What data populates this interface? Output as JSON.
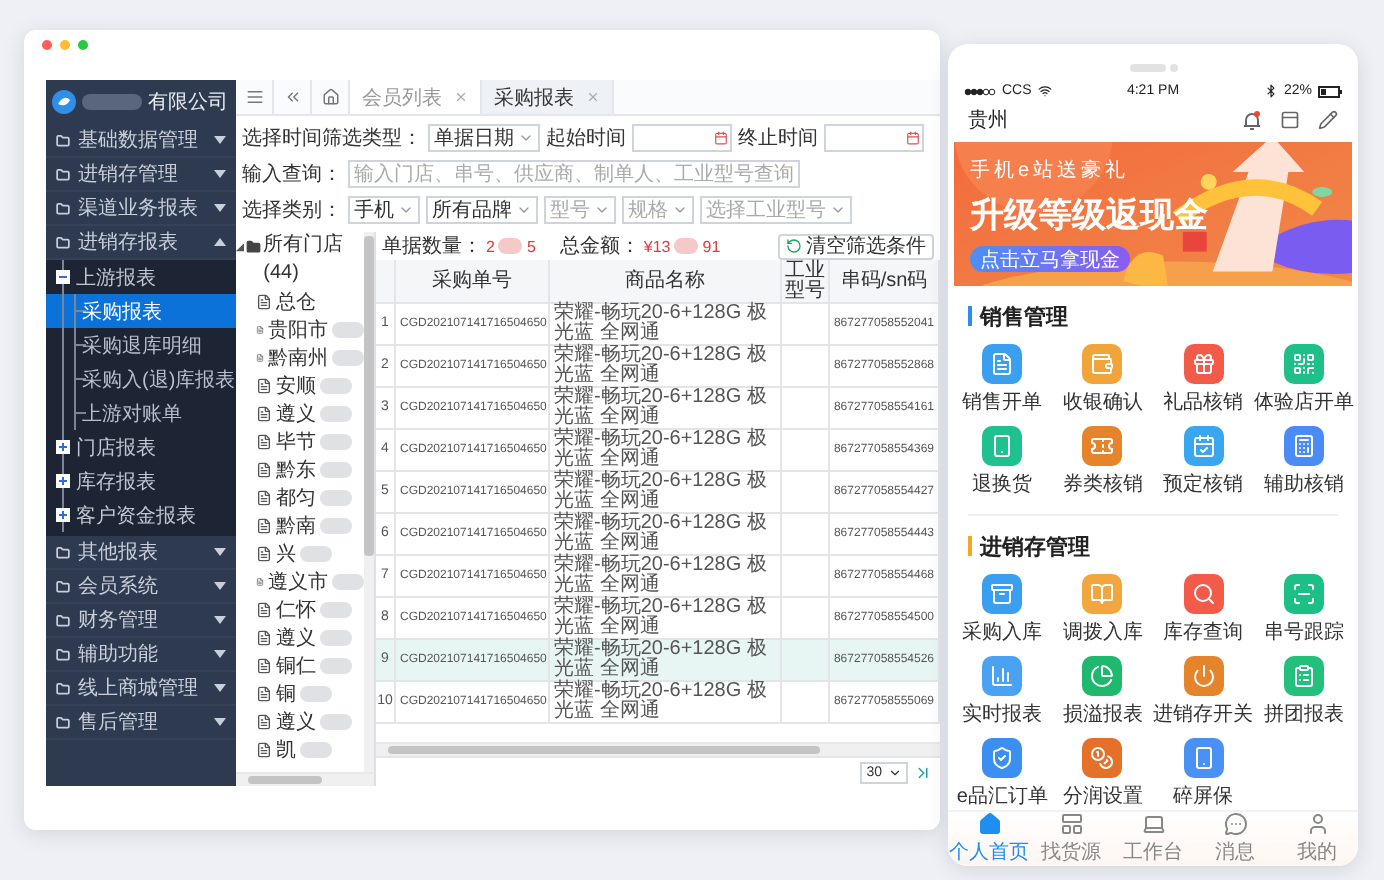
{
  "sidebar": {
    "company": "有限公司",
    "menu": [
      {
        "label": "基础数据管理",
        "expanded": false
      },
      {
        "label": "进销存管理",
        "expanded": false
      },
      {
        "label": "渠道业务报表",
        "expanded": false
      },
      {
        "label": "进销存报表",
        "expanded": true,
        "children": [
          {
            "label": "上游报表",
            "expanded": true,
            "children": [
              {
                "label": "采购报表",
                "selected": true
              },
              {
                "label": "采购退库明细",
                "selected": false
              },
              {
                "label": "采购入(退)库报表",
                "selected": false
              },
              {
                "label": "上游对账单",
                "selected": false
              }
            ]
          },
          {
            "label": "门店报表",
            "expanded": false
          },
          {
            "label": "库存报表",
            "expanded": false
          },
          {
            "label": "客户资金报表",
            "expanded": false
          }
        ]
      },
      {
        "label": "其他报表",
        "expanded": false
      },
      {
        "label": "会员系统",
        "expanded": false
      },
      {
        "label": "财务管理",
        "expanded": false
      },
      {
        "label": "辅助功能",
        "expanded": false
      },
      {
        "label": "线上商城管理",
        "expanded": false
      },
      {
        "label": "售后管理",
        "expanded": false
      }
    ]
  },
  "tabs": [
    {
      "label": "会员列表",
      "selected": false
    },
    {
      "label": "采购报表",
      "selected": true
    }
  ],
  "filters": {
    "time_label": "选择时间筛选类型：",
    "time_type": "单据日期",
    "start_label": "起始时间",
    "end_label": "终止时间",
    "query_label": "输入查询：",
    "query_placeholder": "输入门店、串号、供应商、制单人、工业型号查询",
    "category_label": "选择类别：",
    "dropdowns": [
      {
        "value": "手机"
      },
      {
        "value": "所有品牌"
      },
      {
        "placeholder": "型号"
      },
      {
        "placeholder": "规格"
      },
      {
        "placeholder": "选择工业型号"
      }
    ],
    "clear_button": "清空筛选条件"
  },
  "store_tree": {
    "root": "所有门店 (44)",
    "expanded": true,
    "stores": [
      {
        "name": "总仓",
        "blurred": false
      },
      {
        "name": "贵阳市",
        "blurred": true
      },
      {
        "name": "黔南州",
        "blurred": true
      },
      {
        "name": "安顺",
        "blurred": true
      },
      {
        "name": "遵义",
        "blurred": true
      },
      {
        "name": "毕节",
        "blurred": true
      },
      {
        "name": "黔东",
        "blurred": true
      },
      {
        "name": "都匀",
        "blurred": true
      },
      {
        "name": "黔南",
        "blurred": true
      },
      {
        "name": "兴",
        "blurred": true
      },
      {
        "name": "遵义市",
        "blurred": true
      },
      {
        "name": "仁怀",
        "blurred": true
      },
      {
        "name": "遵义",
        "blurred": true
      },
      {
        "name": "铜仁",
        "blurred": true
      },
      {
        "name": "铜",
        "blurred": true
      },
      {
        "name": "遵义",
        "blurred": true
      },
      {
        "name": "凯",
        "blurred": true
      }
    ]
  },
  "summary": {
    "count_label": "单据数量：",
    "count_parts": [
      "2",
      "5"
    ],
    "amount_label": "总金额：",
    "amount_parts": [
      "¥13",
      "91"
    ]
  },
  "table": {
    "columns": [
      "采购单号",
      "商品名称",
      "工业型号",
      "串码/sn码"
    ],
    "rows": [
      {
        "no": "1",
        "order_no": "CGD202107141716504650",
        "product": "荣耀-畅玩20-6+128G 极光蓝 全网通",
        "imei": "867277058552041",
        "selected": false
      },
      {
        "no": "2",
        "order_no": "CGD202107141716504650",
        "product": "荣耀-畅玩20-6+128G 极光蓝 全网通",
        "imei": "867277058552868",
        "selected": false
      },
      {
        "no": "3",
        "order_no": "CGD202107141716504650",
        "product": "荣耀-畅玩20-6+128G 极光蓝 全网通",
        "imei": "867277058554161",
        "selected": false
      },
      {
        "no": "4",
        "order_no": "CGD202107141716504650",
        "product": "荣耀-畅玩20-6+128G 极光蓝 全网通",
        "imei": "867277058554369",
        "selected": false
      },
      {
        "no": "5",
        "order_no": "CGD202107141716504650",
        "product": "荣耀-畅玩20-6+128G 极光蓝 全网通",
        "imei": "867277058554427",
        "selected": false
      },
      {
        "no": "6",
        "order_no": "CGD202107141716504650",
        "product": "荣耀-畅玩20-6+128G 极光蓝 全网通",
        "imei": "867277058554443",
        "selected": false
      },
      {
        "no": "7",
        "order_no": "CGD202107141716504650",
        "product": "荣耀-畅玩20-6+128G 极光蓝 全网通",
        "imei": "867277058554468",
        "selected": false
      },
      {
        "no": "8",
        "order_no": "CGD202107141716504650",
        "product": "荣耀-畅玩20-6+128G 极光蓝 全网通",
        "imei": "867277058554500",
        "selected": false
      },
      {
        "no": "9",
        "order_no": "CGD202107141716504650",
        "product": "荣耀-畅玩20-6+128G 极光蓝 全网通",
        "imei": "867277058554526",
        "selected": true
      },
      {
        "no": "10",
        "order_no": "CGD202107141716504650",
        "product": "荣耀-畅玩20-6+128G 极光蓝 全网通",
        "imei": "867277058555069",
        "selected": false
      }
    ]
  },
  "pagination": {
    "page_size": "30"
  },
  "phone": {
    "carrier": "CCS",
    "time": "4:21 PM",
    "battery": "22%",
    "city": "贵州",
    "banner": {
      "kicker": "手机e站送豪礼",
      "headline": "升级等级返现金",
      "button": "点击立马拿现金"
    },
    "sections": [
      {
        "title": "销售管理",
        "color": "#2d8cf0",
        "items": [
          {
            "label": "销售开单",
            "color": "#3a9ff0"
          },
          {
            "label": "收银确认",
            "color": "#f0a43a"
          },
          {
            "label": "礼品核销",
            "color": "#f25b4a"
          },
          {
            "label": "体验店开单",
            "color": "#1fbf8a"
          },
          {
            "label": "退换货",
            "color": "#1fc28f"
          },
          {
            "label": "券类核销",
            "color": "#e5842a"
          },
          {
            "label": "预定核销",
            "color": "#3aa6f0"
          },
          {
            "label": "辅助核销",
            "color": "#4a8cf5"
          }
        ]
      },
      {
        "title": "进销存管理",
        "color": "#f5a623",
        "items": [
          {
            "label": "采购入库",
            "color": "#3a9ff0"
          },
          {
            "label": "调拨入库",
            "color": "#f2a73e"
          },
          {
            "label": "库存查询",
            "color": "#f25b4a"
          },
          {
            "label": "串号跟踪",
            "color": "#1cbf86"
          },
          {
            "label": "实时报表",
            "color": "#4aa3f2"
          },
          {
            "label": "损溢报表",
            "color": "#1fb86f"
          },
          {
            "label": "进销存开关",
            "color": "#e5842a"
          },
          {
            "label": "拼团报表",
            "color": "#22c07a"
          },
          {
            "label": "e品汇订单",
            "color": "#3a8ff0"
          },
          {
            "label": "分润设置",
            "color": "#e5702a"
          },
          {
            "label": "碎屏保",
            "color": "#4a90f5"
          }
        ]
      }
    ],
    "nav": [
      {
        "label": "个人首页",
        "selected": true
      },
      {
        "label": "找货源",
        "selected": false
      },
      {
        "label": "工作台",
        "selected": false
      },
      {
        "label": "消息",
        "selected": false
      },
      {
        "label": "我的",
        "selected": false
      }
    ]
  }
}
